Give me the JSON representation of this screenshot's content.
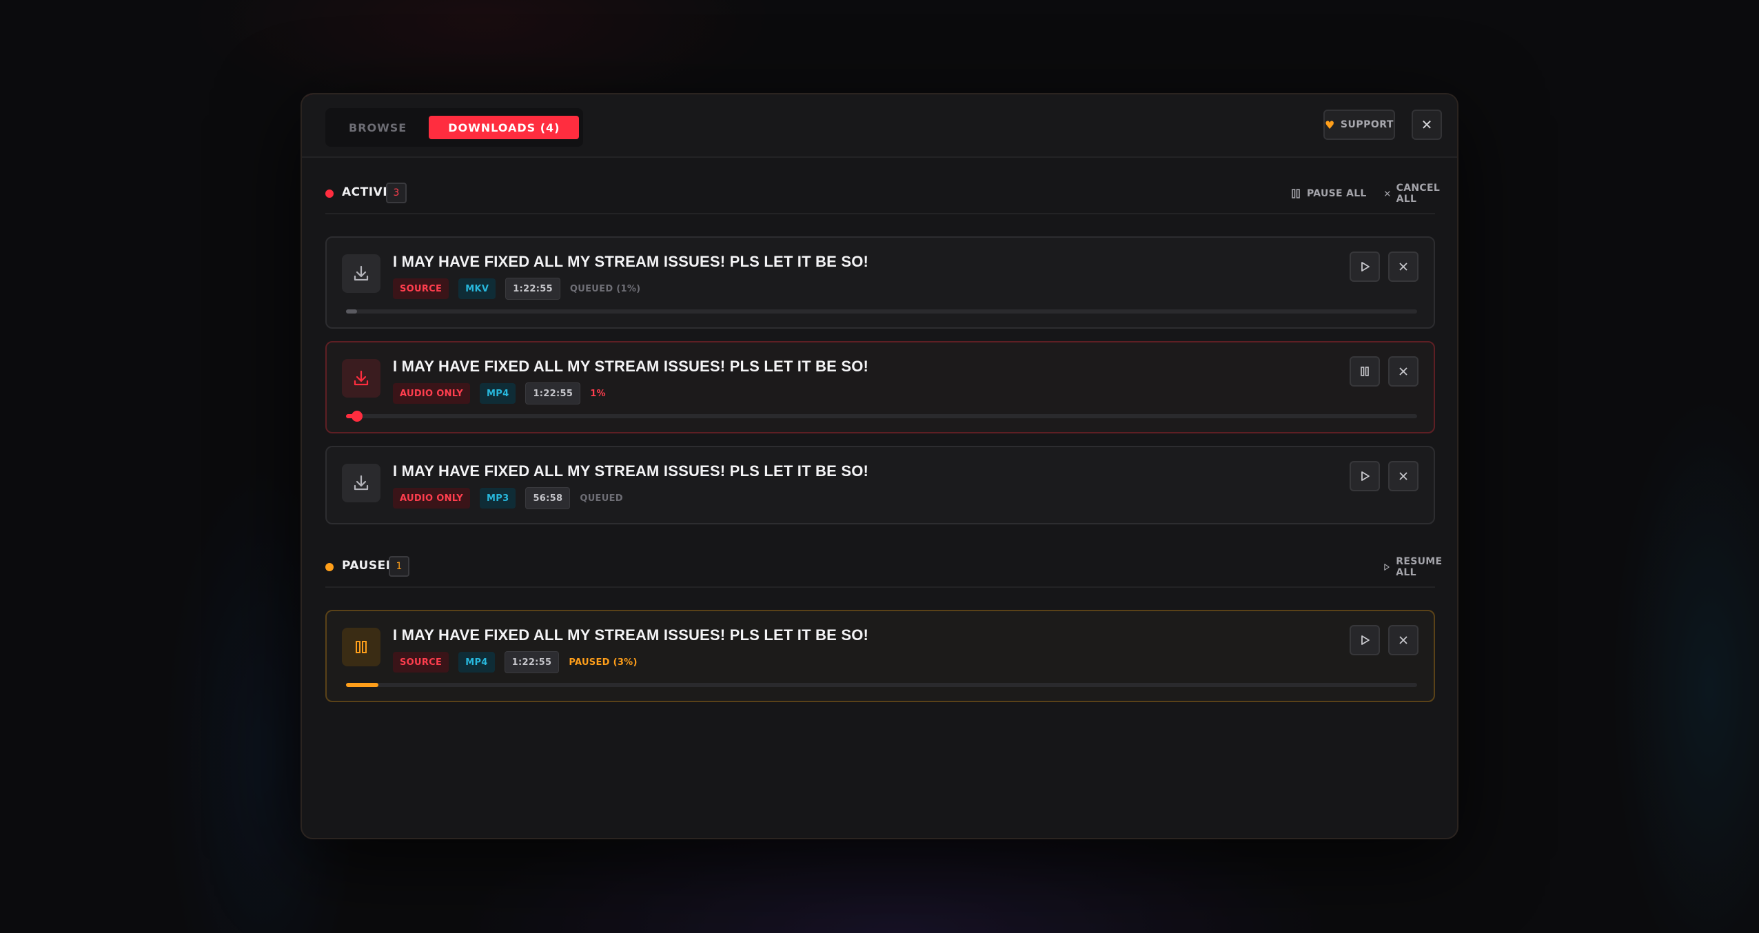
{
  "tabs": [
    {
      "label": "BROWSE",
      "active": false
    },
    {
      "label": "DOWNLOADS (4)",
      "active": true
    }
  ],
  "header": {
    "support_label": "SUPPORT",
    "close_glyph": "✕"
  },
  "colors": {
    "accent": "#ff2d3f",
    "paused": "#ff9f1a",
    "format": "#28b8dd"
  },
  "active": {
    "title": "ACTIVE",
    "count": "3",
    "pause_all_label": "PAUSE ALL",
    "cancel_all_label": "CANCEL ALL",
    "items": [
      {
        "title": "I MAY HAVE FIXED ALL MY STREAM ISSUES! PLS LET IT BE SO!",
        "quality": "SOURCE",
        "format": "MKV",
        "duration": "1:22:55",
        "status": "QUEUED (1%)",
        "progress": 0.01
      },
      {
        "title": "I MAY HAVE FIXED ALL MY STREAM ISSUES! PLS LET IT BE SO!",
        "quality": "AUDIO ONLY",
        "format": "MP4",
        "duration": "1:22:55",
        "status": "1%",
        "progress": 0.01
      },
      {
        "title": "I MAY HAVE FIXED ALL MY STREAM ISSUES! PLS LET IT BE SO!",
        "quality": "AUDIO ONLY",
        "format": "MP3",
        "duration": "56:58",
        "status": "QUEUED"
      }
    ]
  },
  "paused": {
    "title": "PAUSED",
    "count": "1",
    "resume_all_label": "RESUME ALL",
    "items": [
      {
        "title": "I MAY HAVE FIXED ALL MY STREAM ISSUES! PLS LET IT BE SO!",
        "quality": "SOURCE",
        "format": "MP4",
        "duration": "1:22:55",
        "status": "PAUSED (3%)",
        "progress": 0.03
      }
    ]
  }
}
